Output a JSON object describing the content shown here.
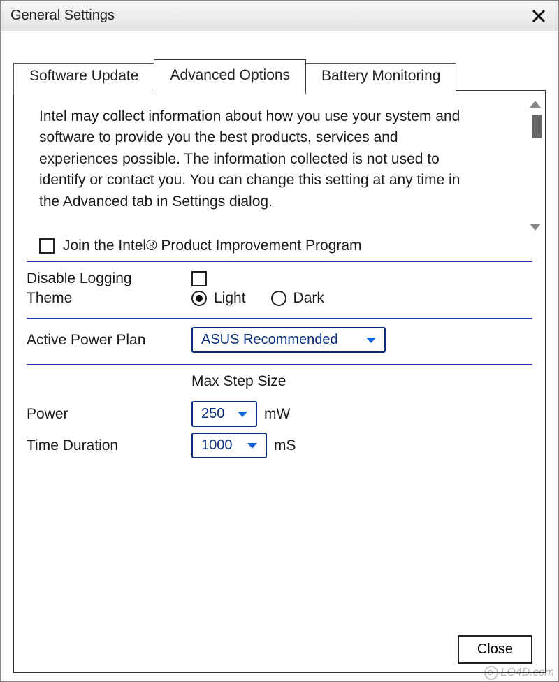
{
  "window": {
    "title": "General Settings"
  },
  "tabs": [
    {
      "label": "Software Update",
      "active": false
    },
    {
      "label": "Advanced Options",
      "active": true
    },
    {
      "label": "Battery Monitoring",
      "active": false
    }
  ],
  "advanced": {
    "info_text": "Intel may collect information about how you use your system and software to provide you the best products, services and experiences possible. The information collected is not used to identify or contact you. You can change this setting at any time in the Advanced tab in Settings dialog.",
    "join_program": {
      "label": "Join the Intel® Product Improvement Program",
      "checked": false
    },
    "disable_logging": {
      "label": "Disable Logging",
      "checked": false
    },
    "theme": {
      "label": "Theme",
      "options": {
        "light": "Light",
        "dark": "Dark"
      },
      "selected": "light"
    },
    "power_plan": {
      "label": "Active Power Plan",
      "value": "ASUS Recommended"
    },
    "step": {
      "heading": "Max Step Size",
      "power": {
        "label": "Power",
        "value": "250",
        "unit": "mW"
      },
      "time": {
        "label": "Time Duration",
        "value": "1000",
        "unit": "mS"
      }
    }
  },
  "buttons": {
    "close": "Close"
  },
  "watermark": "LO4D.com"
}
